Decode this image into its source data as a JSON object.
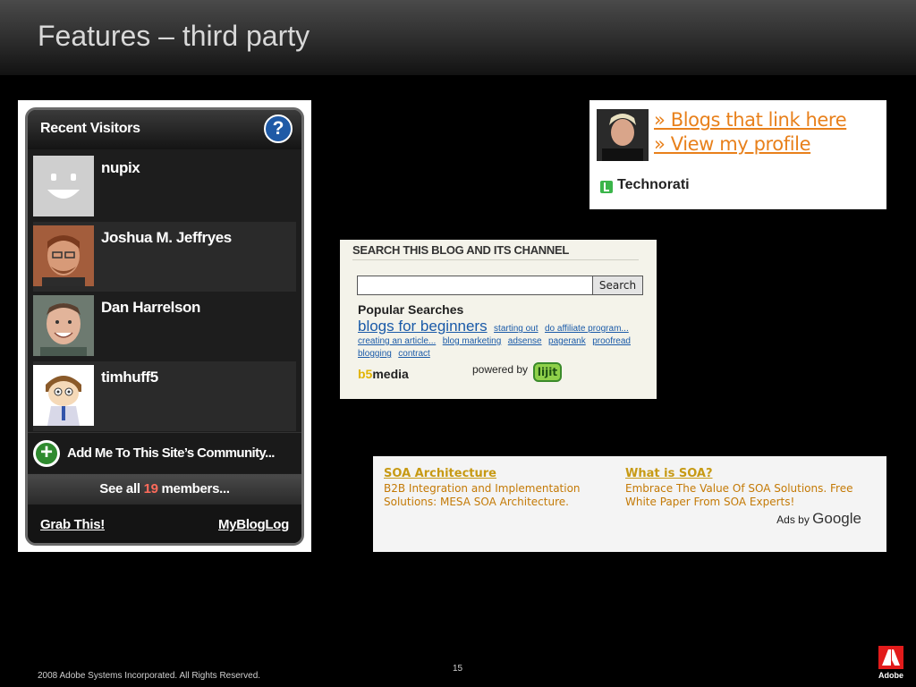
{
  "slide": {
    "title": "Features – third party",
    "footer": "2008 Adobe Systems Incorporated.  All Rights Reserved.",
    "page_number": "15",
    "logo_text": "Adobe"
  },
  "mybloglog": {
    "title": "Recent Visitors",
    "help_icon": "help-icon",
    "visitors": [
      {
        "name": "nupix"
      },
      {
        "name": "Joshua M. Jeffryes"
      },
      {
        "name": "Dan Harrelson"
      },
      {
        "name": "timhuff5"
      }
    ],
    "join_label": "Add Me To This Site’s Community...",
    "see_all_prefix": "See all ",
    "see_all_count": "19",
    "see_all_suffix": " members...",
    "grab_label": "Grab This!",
    "brand_link": "MyBlogLog"
  },
  "technorati": {
    "links": [
      "» Blogs that link here",
      "» View my profile"
    ],
    "logo_text": "Technorati",
    "accent_color": "#e8801b"
  },
  "search_blog": {
    "title": "SEARCH THIS BLOG AND ITS CHANNEL",
    "input_value": "",
    "button_label": "Search",
    "popular_title": "Popular Searches",
    "tags": [
      {
        "label": "blogs for beginners",
        "size": "big"
      },
      {
        "label": "starting out",
        "size": "small"
      },
      {
        "label": "do affiliate program...",
        "size": "small"
      },
      {
        "label": "creating an article...",
        "size": "small"
      },
      {
        "label": "blog marketing",
        "size": "small"
      },
      {
        "label": "adsense",
        "size": "small"
      },
      {
        "label": "pagerank",
        "size": "small"
      },
      {
        "label": "proofread",
        "size": "small"
      },
      {
        "label": "blogging",
        "size": "small"
      },
      {
        "label": "contract",
        "size": "small"
      }
    ],
    "b5_prefix": "b5",
    "b5_suffix": "media",
    "powered_by": "powered by",
    "lijit_logo": "lijit"
  },
  "google_ads": {
    "ads": [
      {
        "title": "SOA Architecture",
        "text": "B2B Integration and Implementation Solutions: MESA SOA Architecture."
      },
      {
        "title": "What is SOA?",
        "text": "Embrace The Value Of SOA Solutions. Free White Paper From SOA Experts!"
      }
    ],
    "ads_by": "Ads by ",
    "google": "Google"
  }
}
